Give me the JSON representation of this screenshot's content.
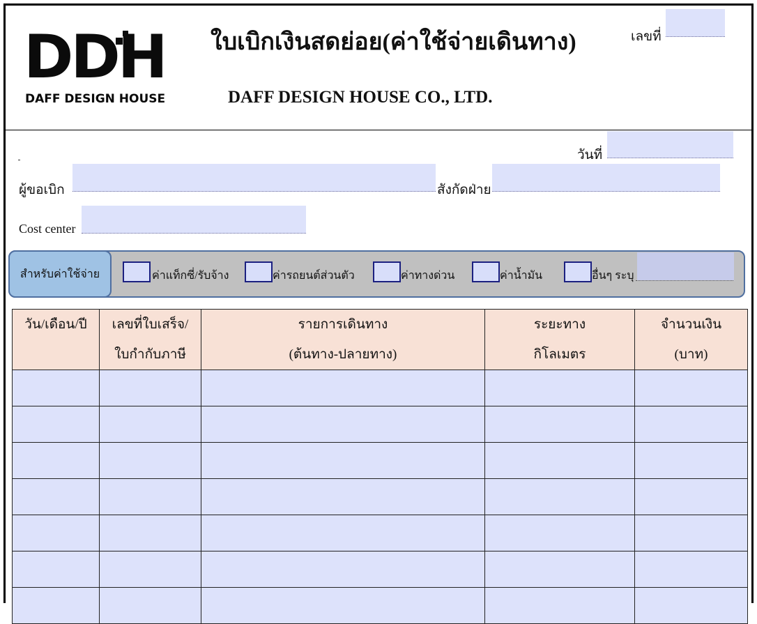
{
  "logo": {
    "mark": "DDH",
    "subtitle": "DAFF DESIGN HOUSE"
  },
  "header": {
    "title_th": "ใบเบิกเงินสดย่อย(ค่าใช้จ่ายเดินทาง)",
    "title_en": "DAFF DESIGN HOUSE CO., LTD.",
    "doc_no_label": "เลขที่"
  },
  "form": {
    "date_label": "วันที่",
    "requester_label": "ผู้ขอเบิก",
    "department_label": "สังกัดฝ่าย",
    "cost_center_label": "Cost center",
    "values": {
      "doc_no": "",
      "date": "",
      "requester": "",
      "department": "",
      "cost_center": "",
      "other": ""
    }
  },
  "expense_types": {
    "label": "สำหรับค่าใช้จ่าย",
    "options": [
      "ค่าแท็กซี่/รับจ้าง",
      "ค่ารถยนต์ส่วนตัว",
      "ค่าทางด่วน",
      "ค่าน้ำมัน",
      "อื่นๆ ระบุ"
    ]
  },
  "table": {
    "headers": [
      {
        "line1": "วัน/เดือน/ปี",
        "line2": ""
      },
      {
        "line1": "เลขที่ใบเสร็จ/",
        "line2": "ใบกำกับภาษี"
      },
      {
        "line1": "รายการเดินทาง",
        "line2": "(ต้นทาง-ปลายทาง)"
      },
      {
        "line1": "ระยะทาง",
        "line2": "กิโลเมตร"
      },
      {
        "line1": "จำนวนเงิน",
        "line2": "(บาท)"
      }
    ],
    "rows": 7
  },
  "colors": {
    "field_fill": "#dde2fb",
    "header_fill": "#f8e1d6",
    "type_label_fill": "#9fc2e4",
    "type_bar_fill": "#c0c0c0",
    "border_blue": "#4f6fa0"
  }
}
